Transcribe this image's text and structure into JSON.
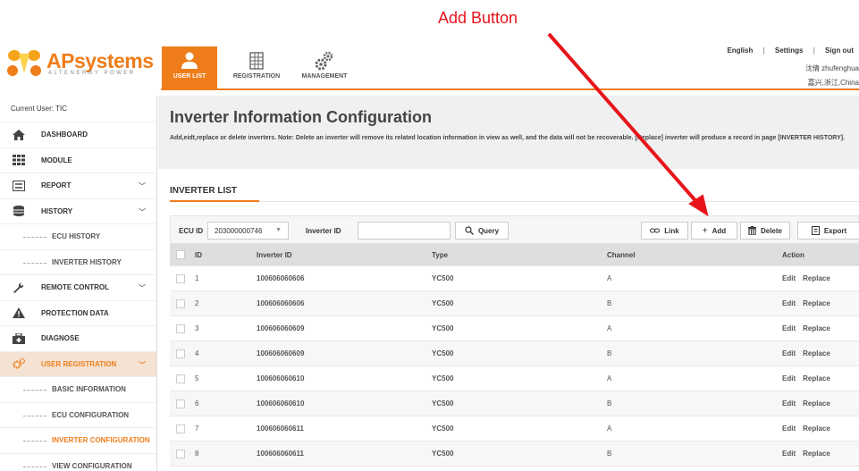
{
  "annotation": {
    "label": "Add Button"
  },
  "brand": {
    "name": "APsystems",
    "name_ap": "AP",
    "name_rest": "systems",
    "sub": "ALTENERGY POWER"
  },
  "nav": {
    "tabs": [
      {
        "label": "USER LIST",
        "icon": "user-icon",
        "active": true
      },
      {
        "label": "REGISTRATION",
        "icon": "grid-icon",
        "active": false
      },
      {
        "label": "MANAGEMENT",
        "icon": "gears-icon",
        "active": false
      }
    ]
  },
  "top_links": {
    "language": "English",
    "settings": "Settings",
    "signout": "Sign out",
    "sep": "|"
  },
  "user_info": {
    "name": "沈倩 zhufenghua",
    "location": "嘉兴,浙江,China"
  },
  "sidebar": {
    "current_user": "Current User: TIC",
    "items": [
      {
        "label": "DASHBOARD",
        "icon": "home-icon"
      },
      {
        "label": "MODULE",
        "icon": "module-icon"
      },
      {
        "label": "REPORT",
        "icon": "report-icon",
        "chevron": "﹀"
      },
      {
        "label": "HISTORY",
        "icon": "database-icon",
        "chevron": "﹀"
      }
    ],
    "history_sub": [
      {
        "label": "ECU HISTORY"
      },
      {
        "label": "INVERTER HISTORY"
      }
    ],
    "items2": [
      {
        "label": "REMOTE CONTROL",
        "icon": "wrench-icon",
        "chevron": "﹀"
      },
      {
        "label": "PROTECTION DATA",
        "icon": "warning-icon"
      },
      {
        "label": "DIAGNOSE",
        "icon": "diagnose-icon"
      },
      {
        "label": "USER REGISTRATION",
        "icon": "gears-icon",
        "chevron": "﹀",
        "active": true
      }
    ],
    "registration_sub": [
      {
        "label": "BASIC INFORMATION"
      },
      {
        "label": "ECU CONFIGURATION"
      },
      {
        "label": "INVERTER CONFIGURATION",
        "active": true
      },
      {
        "label": "VIEW CONFIGURATION"
      }
    ]
  },
  "page": {
    "title": "Inverter Information Configuration",
    "desc": "Add,eidt,replace or delete inverters. Note: Delete an inverter will remove its related location information in view as well, and the data will not be recoverable. [Replace] inverter will produce a record in page [INVERTER HISTORY].",
    "section": "INVERTER LIST"
  },
  "toolbar": {
    "ecu_label": "ECU ID",
    "ecu_value": "203000000746",
    "caret": "▼",
    "inverter_label": "Inverter ID",
    "inverter_value": "",
    "query_label": "Query",
    "link_label": "Link",
    "add_label": "Add",
    "delete_label": "Delete",
    "export_label": "Export"
  },
  "table": {
    "headers": {
      "id": "ID",
      "inverter": "Inverter ID",
      "type": "Type",
      "channel": "Channel",
      "action": "Action"
    },
    "edit_label": "Edit",
    "replace_label": "Replace",
    "rows": [
      {
        "id": "1",
        "inverter": "100606060606",
        "type": "YC500",
        "channel": "A"
      },
      {
        "id": "2",
        "inverter": "100606060606",
        "type": "YC500",
        "channel": "B"
      },
      {
        "id": "3",
        "inverter": "100606060609",
        "type": "YC500",
        "channel": "A"
      },
      {
        "id": "4",
        "inverter": "100606060609",
        "type": "YC500",
        "channel": "B"
      },
      {
        "id": "5",
        "inverter": "100606060610",
        "type": "YC500",
        "channel": "A"
      },
      {
        "id": "6",
        "inverter": "100606060610",
        "type": "YC500",
        "channel": "B"
      },
      {
        "id": "7",
        "inverter": "100606060611",
        "type": "YC500",
        "channel": "A"
      },
      {
        "id": "8",
        "inverter": "100606060611",
        "type": "YC500",
        "channel": "B"
      }
    ]
  },
  "colors": {
    "accent": "#ef7d1a",
    "annotation": "#e8141b"
  }
}
